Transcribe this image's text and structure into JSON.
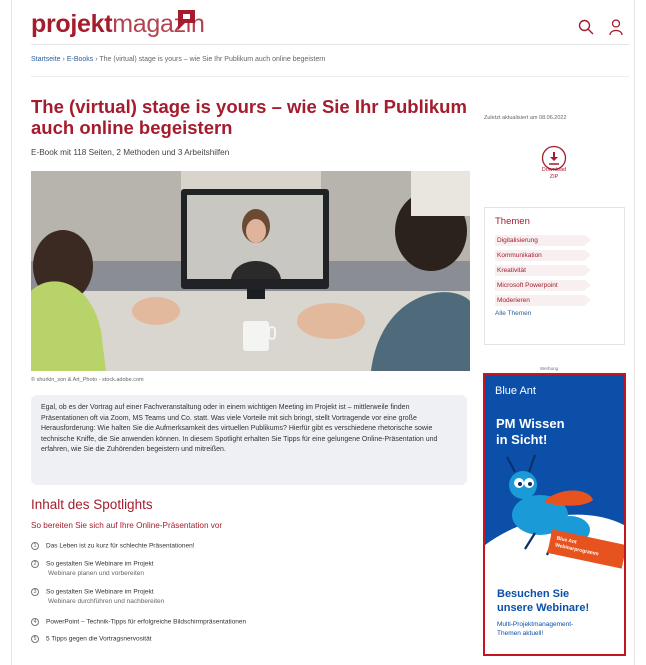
{
  "header": {
    "logo_part1": "projekt",
    "logo_part2": "magazin",
    "icons": [
      "search-icon",
      "user-icon"
    ]
  },
  "breadcrumb": {
    "home": "Startseite",
    "sep1": " › ",
    "ebooks": "E-Books",
    "sep2": " › ",
    "current": "The (virtual) stage is yours – wie Sie Ihr Publikum auch online begeistern"
  },
  "article": {
    "title": "The (virtual) stage is yours – wie Sie Ihr Publikum auch online begeistern",
    "subtitle": "E-Book mit 118 Seiten, 2 Methoden und 3 Arbeitshilfen",
    "image_credit": "© shurkin_son & Art_Photo - stock.adobe.com",
    "intro": "Egal, ob es der Vortrag auf einer Fachveranstaltung oder in einem wichtigen Meeting im Projekt ist – mittlerweile finden Präsentationen oft via Zoom, MS Teams und Co. statt. Was viele Vorteile mit sich bringt, stellt Vortragende vor eine große Herausforderung: Wie halten Sie die Aufmerksamkeit des virtuellen Publikums? Hierfür gibt es verschiedene rhetorische sowie technische Kniffe, die Sie anwenden können. In diesem Spotlight erhalten Sie Tipps für eine gelungene Online-Präsentation und erfahren, wie Sie die Zuhörenden begeistern und mitreißen."
  },
  "toc": {
    "title": "Inhalt des Spotlights",
    "subtitle": "So bereiten Sie sich auf Ihre Online-Präsentation vor",
    "items": [
      {
        "num": "1",
        "title": "Das Leben ist zu kurz für schlechte Präsentationen!",
        "sub": ""
      },
      {
        "num": "2",
        "title": "So gestalten Sie Webinare im Projekt",
        "sub": "Webinare planen und vorbereiten"
      },
      {
        "num": "3",
        "title": "So gestalten Sie Webinare im Projekt",
        "sub": "Webinare durchführen und nachbereiten"
      },
      {
        "num": "4",
        "title": "PowerPoint – Technik-Tipps für erfolgreiche Bildschirmpräsentationen",
        "sub": ""
      },
      {
        "num": "5",
        "title": "5 Tipps gegen die Vortragsnervosität",
        "sub": ""
      }
    ]
  },
  "sidebar": {
    "updated": "Zuletzt aktualisiert am 08.06.2022",
    "download_label": "Download",
    "download_format": "ZIP",
    "themes_title": "Themen",
    "themes": [
      "Digitalisierung",
      "Kommunikation",
      "Kreativität",
      "Microsoft Powerpoint",
      "Moderieren"
    ],
    "all_themes": "Alle Themen"
  },
  "ad": {
    "label": "Werbung",
    "brand": "Blue Ant",
    "headline_1": "PM Wissen",
    "headline_2": "in Sicht!",
    "tag_1": "Blue Ant",
    "tag_2": "Webinarprogramm",
    "cta_1": "Besuchen Sie",
    "cta_2": "unsere Webinare!",
    "text_1": "Multi-Projektmanagement-",
    "text_2": "Themen aktuell!"
  },
  "colors": {
    "brand": "#a41c2d",
    "link": "#2f5f9a",
    "ad_blue": "#0b4fa8",
    "ad_orange": "#e7531e"
  }
}
